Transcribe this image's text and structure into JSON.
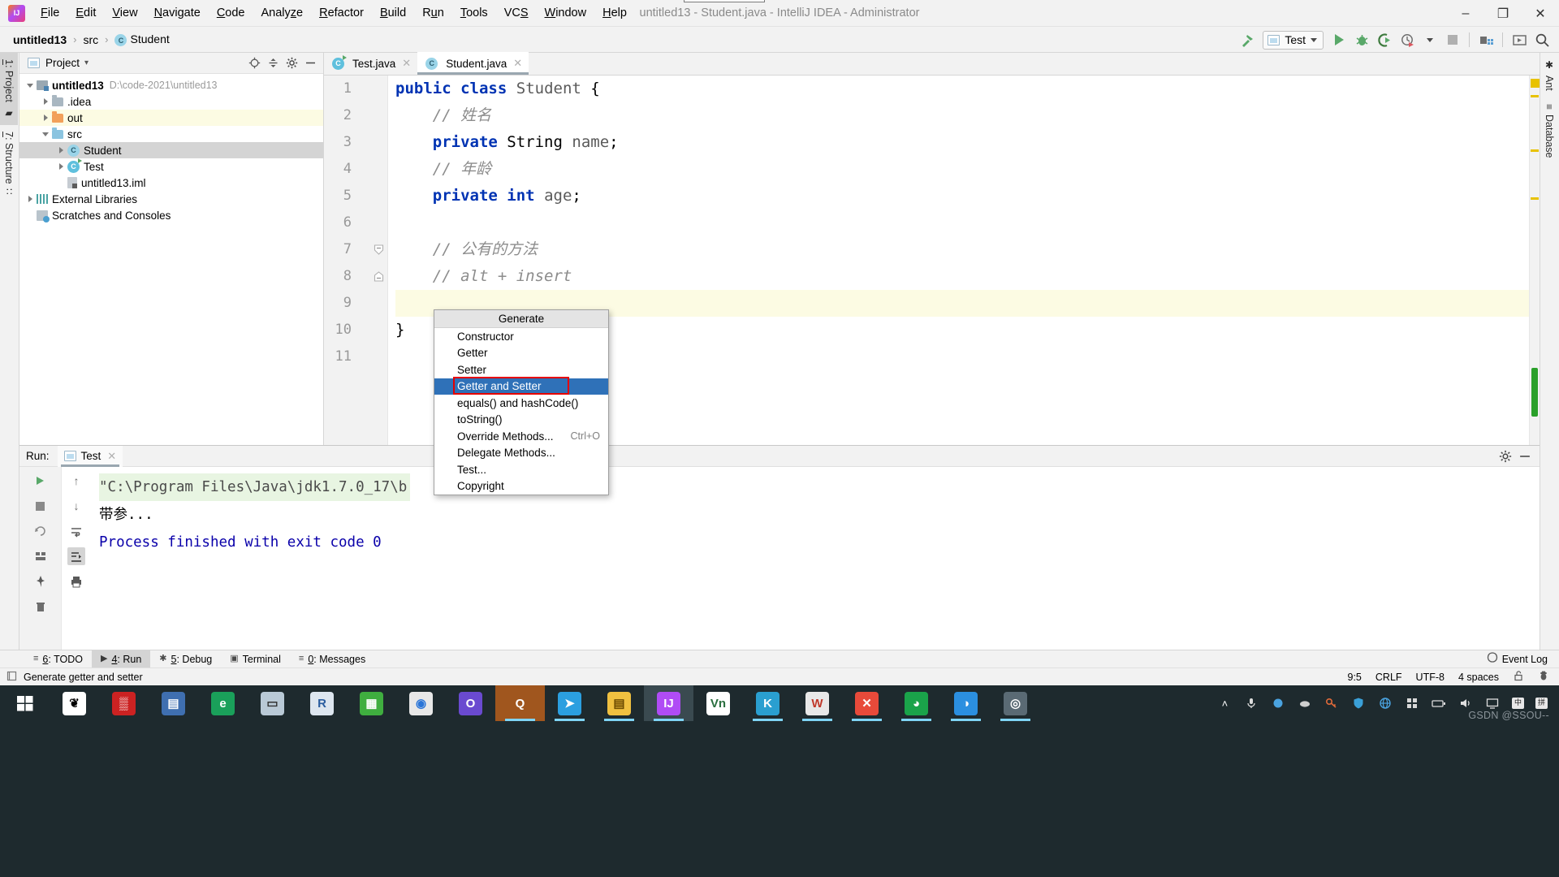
{
  "window": {
    "title": "untitled13 - Student.java - IntelliJ IDEA - Administrator",
    "minimize": "–",
    "maximize": "❐",
    "close": "✕"
  },
  "menu": {
    "items": [
      {
        "label": "File",
        "mnemonic": "F"
      },
      {
        "label": "Edit",
        "mnemonic": "E"
      },
      {
        "label": "View",
        "mnemonic": "V"
      },
      {
        "label": "Navigate",
        "mnemonic": "N"
      },
      {
        "label": "Code",
        "mnemonic": "C"
      },
      {
        "label": "Analyze",
        "mnemonic": "z"
      },
      {
        "label": "Refactor",
        "mnemonic": "R"
      },
      {
        "label": "Build",
        "mnemonic": "B"
      },
      {
        "label": "Run",
        "mnemonic": "u"
      },
      {
        "label": "Tools",
        "mnemonic": "T"
      },
      {
        "label": "VCS",
        "mnemonic": "S"
      },
      {
        "label": "Window",
        "mnemonic": "W"
      },
      {
        "label": "Help",
        "mnemonic": "H"
      }
    ]
  },
  "breadcrumb": {
    "project": "untitled13",
    "sep": "›",
    "folder": "src",
    "file": "Student",
    "file_badge": "C"
  },
  "toolbar": {
    "build_icon": "hammer-icon",
    "run_config": "Test",
    "run_icon": "run-icon",
    "debug_icon": "debug-icon",
    "coverage_icon": "coverage-icon",
    "profile_icon": "profile-icon",
    "stop_icon": "stop-icon",
    "project_structure_icon": "project-structure-icon",
    "updates_icon": "updates-icon",
    "search_icon": "search-icon"
  },
  "left_tool_tabs": [
    {
      "label": "1: Project",
      "num": "1",
      "rest": ": Project",
      "icon": "project-icon",
      "active": true
    },
    {
      "label": "7: Structure",
      "num": "7",
      "rest": ": Structure",
      "icon": "structure-icon",
      "active": false
    }
  ],
  "right_tool_tabs": [
    {
      "label": "Ant",
      "icon": "ant-icon"
    },
    {
      "label": "Database",
      "icon": "database-icon"
    }
  ],
  "project_panel": {
    "title": "Project",
    "dropdown_caret": "▾",
    "icons": [
      "locate-icon",
      "collapse-all-icon",
      "settings-gear-icon",
      "hide-icon"
    ],
    "tree": [
      {
        "name": "untitled13",
        "path": "D:\\code-2021\\untitled13",
        "indent": 0,
        "arrow": "open",
        "icon": "module",
        "bold": true,
        "state": "none"
      },
      {
        "name": ".idea",
        "path": "",
        "indent": 1,
        "arrow": "closed",
        "icon": "folder-gray",
        "bold": false,
        "state": "none"
      },
      {
        "name": "out",
        "path": "",
        "indent": 1,
        "arrow": "closed",
        "icon": "folder-orange",
        "bold": false,
        "state": "highlight"
      },
      {
        "name": "src",
        "path": "",
        "indent": 1,
        "arrow": "open",
        "icon": "folder-blue",
        "bold": false,
        "state": "none"
      },
      {
        "name": "Student",
        "path": "",
        "indent": 2,
        "arrow": "closed",
        "icon": "class",
        "bold": false,
        "state": "selected"
      },
      {
        "name": "Test",
        "path": "",
        "indent": 2,
        "arrow": "closed",
        "icon": "class-runnable",
        "bold": false,
        "state": "none"
      },
      {
        "name": "untitled13.iml",
        "path": "",
        "indent": 2,
        "arrow": "none",
        "icon": "file",
        "bold": false,
        "state": "none"
      },
      {
        "name": "External Libraries",
        "path": "",
        "indent": 0,
        "arrow": "closed",
        "icon": "library",
        "bold": false,
        "state": "none"
      },
      {
        "name": "Scratches and Consoles",
        "path": "",
        "indent": 0,
        "arrow": "none",
        "icon": "scratch",
        "bold": false,
        "state": "none"
      }
    ]
  },
  "editor": {
    "tabs": [
      {
        "label": "Test.java",
        "icon": "class-runnable",
        "active": false
      },
      {
        "label": "Student.java",
        "icon": "class",
        "active": true
      }
    ],
    "close_glyph": "✕",
    "line_numbers": [
      "1",
      "2",
      "3",
      "4",
      "5",
      "6",
      "7",
      "8",
      "9",
      "10",
      "11"
    ],
    "lines": [
      {
        "n": 1,
        "tokens": [
          {
            "t": "public",
            "c": "kw"
          },
          {
            "t": " ",
            "c": "plain"
          },
          {
            "t": "class",
            "c": "kw"
          },
          {
            "t": " ",
            "c": "plain"
          },
          {
            "t": "Student",
            "c": "idn"
          },
          {
            "t": " {",
            "c": "plain"
          }
        ],
        "caret": false
      },
      {
        "n": 2,
        "tokens": [
          {
            "t": "    // 姓名",
            "c": "cmt"
          }
        ],
        "caret": false
      },
      {
        "n": 3,
        "tokens": [
          {
            "t": "    ",
            "c": "plain"
          },
          {
            "t": "private",
            "c": "kw"
          },
          {
            "t": " ",
            "c": "plain"
          },
          {
            "t": "String",
            "c": "typ"
          },
          {
            "t": " ",
            "c": "plain"
          },
          {
            "t": "name",
            "c": "idn"
          },
          {
            "t": ";",
            "c": "plain"
          }
        ],
        "caret": false
      },
      {
        "n": 4,
        "tokens": [
          {
            "t": "    // 年龄",
            "c": "cmt"
          }
        ],
        "caret": false
      },
      {
        "n": 5,
        "tokens": [
          {
            "t": "    ",
            "c": "plain"
          },
          {
            "t": "private",
            "c": "kw"
          },
          {
            "t": " ",
            "c": "plain"
          },
          {
            "t": "int",
            "c": "kw"
          },
          {
            "t": " ",
            "c": "plain"
          },
          {
            "t": "age",
            "c": "idn"
          },
          {
            "t": ";",
            "c": "plain"
          }
        ],
        "caret": false
      },
      {
        "n": 6,
        "tokens": [
          {
            "t": "",
            "c": "plain"
          }
        ],
        "caret": false
      },
      {
        "n": 7,
        "tokens": [
          {
            "t": "    // 公有的方法",
            "c": "cmt"
          }
        ],
        "caret": false
      },
      {
        "n": 8,
        "tokens": [
          {
            "t": "    // alt + insert",
            "c": "cmt"
          }
        ],
        "caret": false
      },
      {
        "n": 9,
        "tokens": [
          {
            "t": "",
            "c": "plain"
          }
        ],
        "caret": true
      },
      {
        "n": 10,
        "tokens": [
          {
            "t": "}",
            "c": "plain"
          }
        ],
        "caret": false
      },
      {
        "n": 11,
        "tokens": [
          {
            "t": "",
            "c": "plain"
          }
        ],
        "caret": false
      }
    ]
  },
  "generate_popup": {
    "title": "Generate",
    "items": [
      {
        "label": "Constructor",
        "shortcut": "",
        "selected": false
      },
      {
        "label": "Getter",
        "shortcut": "",
        "selected": false
      },
      {
        "label": "Setter",
        "shortcut": "",
        "selected": false
      },
      {
        "label": "Getter and Setter",
        "shortcut": "",
        "selected": true
      },
      {
        "label": "equals() and hashCode()",
        "shortcut": "",
        "selected": false
      },
      {
        "label": "toString()",
        "shortcut": "",
        "selected": false
      },
      {
        "label": "Override Methods...",
        "shortcut": "Ctrl+O",
        "selected": false
      },
      {
        "label": "Delegate Methods...",
        "shortcut": "",
        "selected": false
      },
      {
        "label": "Test...",
        "shortcut": "",
        "selected": false
      },
      {
        "label": "Copyright",
        "shortcut": "",
        "selected": false
      }
    ],
    "annotation_color": "#e60000"
  },
  "run_panel": {
    "label": "Run:",
    "tab": "Test",
    "close_glyph": "✕",
    "gear_icon": "settings-gear-icon",
    "hide_icon": "hide-icon",
    "console": {
      "command": "\"C:\\Program Files\\Java\\jdk1.7.0_17\\b",
      "output": "带参...",
      "blank": "",
      "finished": "Process finished with exit code 0"
    },
    "left_buttons": [
      "rerun-icon",
      "stop-icon",
      "rerun-failed-icon",
      "layout-icon",
      "pin-icon",
      "trash-icon"
    ],
    "mid_buttons": [
      "scroll-up-icon",
      "scroll-down-icon",
      "soft-wrap-icon",
      "scroll-to-end-icon",
      "print-icon"
    ]
  },
  "bottom_tabs": [
    {
      "num": "6",
      "rest": ": TODO",
      "icon": "todo-icon",
      "active": false
    },
    {
      "num": "4",
      "rest": ": Run",
      "icon": "run-icon",
      "active": true
    },
    {
      "num": "5",
      "rest": ": Debug",
      "icon": "debug-icon",
      "active": false
    },
    {
      "num": "",
      "rest": "Terminal",
      "icon": "terminal-icon",
      "active": false
    },
    {
      "num": "0",
      "rest": ": Messages",
      "icon": "messages-icon",
      "active": false
    }
  ],
  "event_log": {
    "label": "Event Log",
    "icon": "event-log-icon"
  },
  "statusbar": {
    "message": "Generate getter and setter",
    "message_icon": "info-icon",
    "caret": "9:5",
    "line_sep": "CRLF",
    "encoding": "UTF-8",
    "indent": "4 spaces",
    "lock_icon": "lock-icon",
    "inspector_icon": "inspector-icon"
  },
  "taskbar": {
    "start_icon": "windows-start-icon",
    "apps": [
      {
        "name": "sogou-icon",
        "glyph": "❦",
        "bg": "#ffffff",
        "fg": "#000000",
        "state": "none"
      },
      {
        "name": "grid-red-icon",
        "glyph": "▒",
        "bg": "#cc2222",
        "fg": "#ffffff",
        "state": "none"
      },
      {
        "name": "reader-icon",
        "glyph": "▤",
        "bg": "#3f6fb0",
        "fg": "#ffffff",
        "state": "none"
      },
      {
        "name": "edge-icon",
        "glyph": "e",
        "bg": "#1aa05a",
        "fg": "#ffffff",
        "state": "none"
      },
      {
        "name": "notepad-icon",
        "glyph": "▭",
        "bg": "#b9c9d6",
        "fg": "#333333",
        "state": "none"
      },
      {
        "name": "rstudio-icon",
        "glyph": "R",
        "bg": "#dde6ef",
        "fg": "#2a5d9f",
        "state": "none"
      },
      {
        "name": "qq-green-icon",
        "glyph": "▦",
        "bg": "#3fae3f",
        "fg": "#ffffff",
        "state": "none"
      },
      {
        "name": "chrome-icon",
        "glyph": "◉",
        "bg": "#e8e8e8",
        "fg": "#2a75d8",
        "state": "none"
      },
      {
        "name": "outlook-icon",
        "glyph": "O",
        "bg": "#6a4ad0",
        "fg": "#ffffff",
        "state": "none"
      },
      {
        "name": "qq-browser-icon",
        "glyph": "Q",
        "bg": "#a0561e",
        "fg": "#ffffff",
        "state": "active2"
      },
      {
        "name": "telegram-icon",
        "glyph": "➤",
        "bg": "#2b9fe0",
        "fg": "#ffffff",
        "state": "running"
      },
      {
        "name": "explorer-icon",
        "glyph": "▤",
        "bg": "#f0c040",
        "fg": "#6b4a00",
        "state": "running"
      },
      {
        "name": "intellij-icon",
        "glyph": "IJ",
        "bg": "#b04cf5",
        "fg": "#ffffff",
        "state": "active"
      },
      {
        "name": "vnc-icon",
        "glyph": "Vn",
        "bg": "#ffffff",
        "fg": "#2a6f3f",
        "state": "none"
      },
      {
        "name": "kugou-icon",
        "glyph": "K",
        "bg": "#2a9fd0",
        "fg": "#ffffff",
        "state": "running"
      },
      {
        "name": "wps-icon",
        "glyph": "W",
        "bg": "#e8e8e8",
        "fg": "#c0392b",
        "state": "running"
      },
      {
        "name": "xmind-icon",
        "glyph": "✕",
        "bg": "#e84a3a",
        "fg": "#ffffff",
        "state": "running"
      },
      {
        "name": "wechat-icon",
        "glyph": "◕",
        "bg": "#1aa34a",
        "fg": "#ffffff",
        "state": "running"
      },
      {
        "name": "dingtalk-icon",
        "glyph": "◑",
        "bg": "#2b8fe0",
        "fg": "#ffffff",
        "state": "running"
      },
      {
        "name": "camera-icon",
        "glyph": "◎",
        "bg": "#5a6a74",
        "fg": "#ffffff",
        "state": "running"
      }
    ],
    "tray": {
      "chevron": "˄",
      "icons": [
        "mic-icon",
        "vpn-icon",
        "cloud-icon",
        "key-icon",
        "shield-icon",
        "globe-icon",
        "grid-icon",
        "battery-icon",
        "volume-icon",
        "monitor-icon"
      ],
      "ime": "中",
      "ime_sub": "拼"
    },
    "watermark": "GSDN @SSOU‑‑"
  }
}
